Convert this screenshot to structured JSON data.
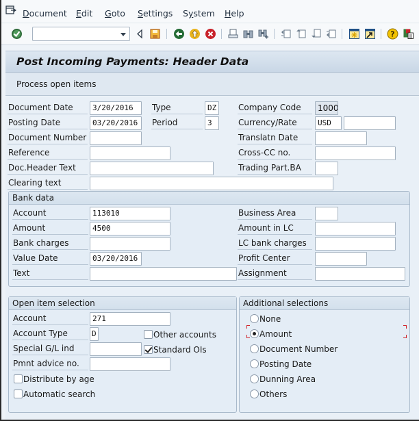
{
  "menu": {
    "items": [
      {
        "label": "Document",
        "mnemonic": "D"
      },
      {
        "label": "Edit",
        "mnemonic": "E"
      },
      {
        "label": "Goto",
        "mnemonic": "G"
      },
      {
        "label": "Settings",
        "mnemonic": "S"
      },
      {
        "label": "System",
        "mnemonic": "y"
      },
      {
        "label": "Help",
        "mnemonic": "H"
      }
    ]
  },
  "toolbar": {
    "command_field": {
      "value": "",
      "placeholder": ""
    },
    "icons": [
      "enter-icon",
      "back-arrow-icon",
      "save-icon",
      "back-icon",
      "exit-icon",
      "cancel-icon",
      "print-icon",
      "find-icon",
      "find-next-icon",
      "first-page-icon",
      "previous-page-icon",
      "next-page-icon",
      "last-page-icon",
      "new-session-icon",
      "create-shortcut-icon",
      "help-icon",
      "customize-layout-icon"
    ]
  },
  "title": "Post Incoming Payments: Header Data",
  "app_toolbar": {
    "process_open_items": "Process open items"
  },
  "header": {
    "document_date": {
      "label": "Document Date",
      "value": "3/20/2016"
    },
    "type": {
      "label": "Type",
      "value": "DZ"
    },
    "company_code": {
      "label": "Company Code",
      "value": "1000"
    },
    "posting_date": {
      "label": "Posting Date",
      "value": "03/20/2016"
    },
    "period": {
      "label": "Period",
      "value": "3"
    },
    "currency_rate": {
      "label": "Currency/Rate",
      "currency": "USD",
      "rate": ""
    },
    "document_number": {
      "label": "Document Number",
      "value": ""
    },
    "translatn_date": {
      "label": "Translatn Date",
      "value": ""
    },
    "reference": {
      "label": "Reference",
      "value": ""
    },
    "cross_cc_no": {
      "label": "Cross-CC no.",
      "value": ""
    },
    "doc_header_text": {
      "label": "Doc.Header Text",
      "value": ""
    },
    "trading_part_ba": {
      "label": "Trading Part.BA",
      "value": ""
    },
    "clearing_text": {
      "label": "Clearing text",
      "value": ""
    }
  },
  "bank_data": {
    "title": "Bank data",
    "account": {
      "label": "Account",
      "value": "113010"
    },
    "business_area": {
      "label": "Business Area",
      "value": ""
    },
    "amount": {
      "label": "Amount",
      "value": "4500"
    },
    "amount_in_lc": {
      "label": "Amount in LC",
      "value": ""
    },
    "bank_charges": {
      "label": "Bank charges",
      "value": ""
    },
    "lc_bank_charges": {
      "label": "LC bank charges",
      "value": ""
    },
    "value_date": {
      "label": "Value Date",
      "value": "03/20/2016"
    },
    "profit_center": {
      "label": "Profit Center",
      "value": ""
    },
    "text": {
      "label": "Text",
      "value": ""
    },
    "assignment": {
      "label": "Assignment",
      "value": ""
    }
  },
  "open_item_selection": {
    "title": "Open item selection",
    "account": {
      "label": "Account",
      "value": "271"
    },
    "account_type": {
      "label": "Account Type",
      "value": "D"
    },
    "other_accounts": {
      "label": "Other accounts",
      "checked": false
    },
    "special_gl_ind": {
      "label": "Special G/L ind",
      "value": ""
    },
    "standard_ois": {
      "label": "Standard OIs",
      "checked": true
    },
    "pmnt_advice_no": {
      "label": "Pmnt advice no.",
      "value": ""
    },
    "distribute_by_age": {
      "label": "Distribute by age",
      "checked": false
    },
    "automatic_search": {
      "label": "Automatic search",
      "checked": false
    }
  },
  "additional_selections": {
    "title": "Additional selections",
    "selected": "Amount",
    "options": [
      "None",
      "Amount",
      "Document Number",
      "Posting Date",
      "Dunning Area",
      "Others"
    ]
  },
  "colors": {
    "focus_marker": "#d0242c",
    "title_bar": "#c9d7e6",
    "form_background": "#e9f0f7"
  }
}
